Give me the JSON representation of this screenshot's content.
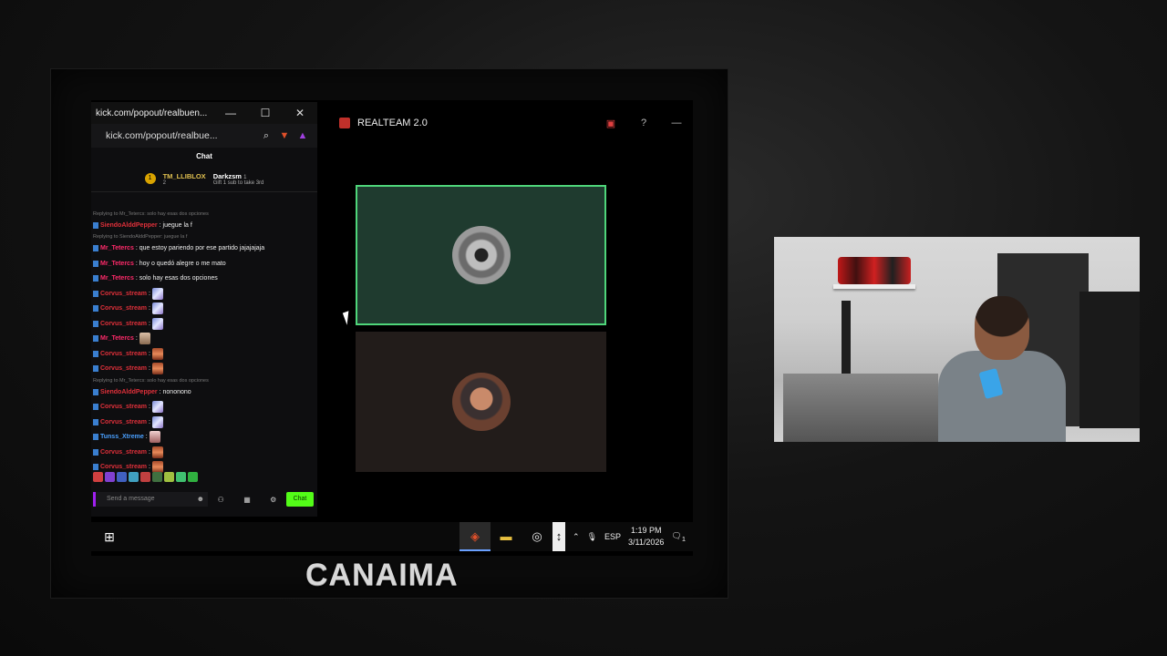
{
  "popout": {
    "title": "kick.com/popout/realbuen...",
    "minimize_icon": "—",
    "maximize_icon": "☐",
    "close_icon": "✕",
    "url": "kick.com/popout/realbue..."
  },
  "chat": {
    "header": "Chat",
    "pinned": {
      "badge": "1",
      "user1": "TM_LLIBLOX",
      "user1_count": "2",
      "user2": "Darkzsm",
      "user2_count": "1",
      "subtext": "Gift 1 sub to take 3rd"
    },
    "messages": [
      {
        "type": "reply",
        "text": "Replying to Mr_Tetercs: solo hay esas dos opciones"
      },
      {
        "type": "msg",
        "user": "SiendoAlddPepper",
        "color": "red",
        "text": ": juegue la f"
      },
      {
        "type": "reply",
        "text": "Replying to SiendoAlddPepper: juegue la f"
      },
      {
        "type": "msg",
        "user": "Mr_Tetercs",
        "color": "pink",
        "text": ": que estoy pariendo por ese partido jajajajaja"
      },
      {
        "type": "msg",
        "user": "Mr_Tetercs",
        "color": "pink",
        "text": ": hoy o quedó alegre o me mato"
      },
      {
        "type": "msg",
        "user": "Mr_Tetercs",
        "color": "pink",
        "text": ": solo hay esas dos opciones"
      },
      {
        "type": "msg",
        "user": "Corvus_stream",
        "color": "red",
        "text": ":",
        "emote": "flag"
      },
      {
        "type": "msg",
        "user": "Corvus_stream",
        "color": "red",
        "text": ":",
        "emote": "flag"
      },
      {
        "type": "msg",
        "user": "Corvus_stream",
        "color": "red",
        "text": ":",
        "emote": "flag"
      },
      {
        "type": "msg",
        "user": "Mr_Tetercs",
        "color": "pink",
        "text": ":",
        "emote": "cat"
      },
      {
        "type": "msg",
        "user": "Corvus_stream",
        "color": "red",
        "text": ":",
        "emote": "face"
      },
      {
        "type": "msg",
        "user": "Corvus_stream",
        "color": "red",
        "text": ":",
        "emote": "face"
      },
      {
        "type": "reply",
        "text": "Replying to Mr_Tetercs: solo hay esas dos opciones"
      },
      {
        "type": "msg",
        "user": "SiendoAlddPepper",
        "color": "red",
        "text": ": nononono"
      },
      {
        "type": "msg",
        "user": "Corvus_stream",
        "color": "red",
        "text": ":",
        "emote": "flag"
      },
      {
        "type": "msg",
        "user": "Corvus_stream",
        "color": "red",
        "text": ":",
        "emote": "flag"
      },
      {
        "type": "msg",
        "user": "Tunss_Xtreme",
        "color": "blue",
        "text": ":",
        "emote": "pic"
      },
      {
        "type": "msg",
        "user": "Corvus_stream",
        "color": "red",
        "text": ":",
        "emote": "face"
      },
      {
        "type": "msg",
        "user": "Corvus_stream",
        "color": "red",
        "text": ":",
        "emote": "face"
      }
    ],
    "input_placeholder": "Send a message",
    "send_label": "Chat"
  },
  "voice": {
    "title": "REALTEAM 2.0"
  },
  "taskbar": {
    "start_icon": "⊞",
    "language": "ESP",
    "time": "1:19 PM",
    "date": "3/11/2026",
    "notification_count": "1"
  },
  "brand": "CANAIMA",
  "colors": {
    "kick_green": "#53fc18",
    "speaking_border": "#4fd67a",
    "tile_active_bg": "#1f3b2f"
  }
}
